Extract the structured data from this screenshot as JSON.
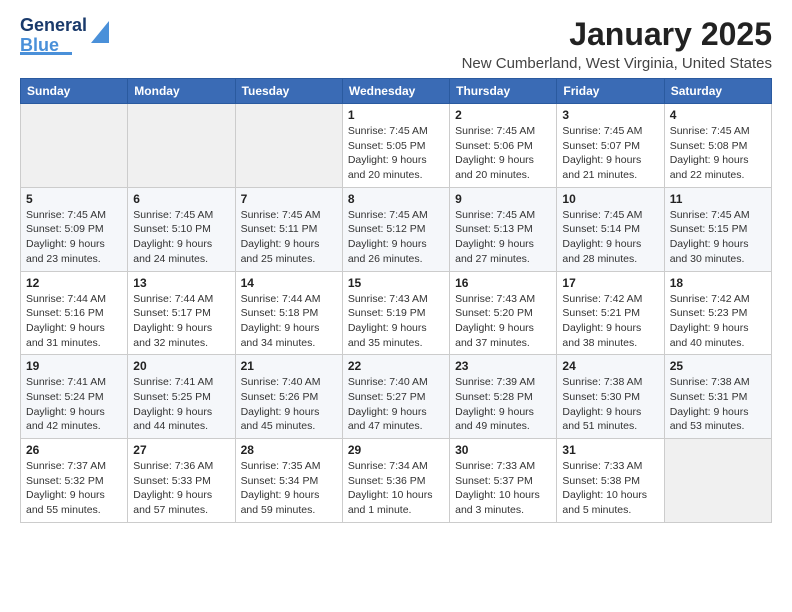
{
  "logo": {
    "line1": "General",
    "line2": "Blue"
  },
  "header": {
    "month": "January 2025",
    "location": "New Cumberland, West Virginia, United States"
  },
  "weekdays": [
    "Sunday",
    "Monday",
    "Tuesday",
    "Wednesday",
    "Thursday",
    "Friday",
    "Saturday"
  ],
  "weeks": [
    [
      {
        "day": "",
        "info": ""
      },
      {
        "day": "",
        "info": ""
      },
      {
        "day": "",
        "info": ""
      },
      {
        "day": "1",
        "info": "Sunrise: 7:45 AM\nSunset: 5:05 PM\nDaylight: 9 hours\nand 20 minutes."
      },
      {
        "day": "2",
        "info": "Sunrise: 7:45 AM\nSunset: 5:06 PM\nDaylight: 9 hours\nand 20 minutes."
      },
      {
        "day": "3",
        "info": "Sunrise: 7:45 AM\nSunset: 5:07 PM\nDaylight: 9 hours\nand 21 minutes."
      },
      {
        "day": "4",
        "info": "Sunrise: 7:45 AM\nSunset: 5:08 PM\nDaylight: 9 hours\nand 22 minutes."
      }
    ],
    [
      {
        "day": "5",
        "info": "Sunrise: 7:45 AM\nSunset: 5:09 PM\nDaylight: 9 hours\nand 23 minutes."
      },
      {
        "day": "6",
        "info": "Sunrise: 7:45 AM\nSunset: 5:10 PM\nDaylight: 9 hours\nand 24 minutes."
      },
      {
        "day": "7",
        "info": "Sunrise: 7:45 AM\nSunset: 5:11 PM\nDaylight: 9 hours\nand 25 minutes."
      },
      {
        "day": "8",
        "info": "Sunrise: 7:45 AM\nSunset: 5:12 PM\nDaylight: 9 hours\nand 26 minutes."
      },
      {
        "day": "9",
        "info": "Sunrise: 7:45 AM\nSunset: 5:13 PM\nDaylight: 9 hours\nand 27 minutes."
      },
      {
        "day": "10",
        "info": "Sunrise: 7:45 AM\nSunset: 5:14 PM\nDaylight: 9 hours\nand 28 minutes."
      },
      {
        "day": "11",
        "info": "Sunrise: 7:45 AM\nSunset: 5:15 PM\nDaylight: 9 hours\nand 30 minutes."
      }
    ],
    [
      {
        "day": "12",
        "info": "Sunrise: 7:44 AM\nSunset: 5:16 PM\nDaylight: 9 hours\nand 31 minutes."
      },
      {
        "day": "13",
        "info": "Sunrise: 7:44 AM\nSunset: 5:17 PM\nDaylight: 9 hours\nand 32 minutes."
      },
      {
        "day": "14",
        "info": "Sunrise: 7:44 AM\nSunset: 5:18 PM\nDaylight: 9 hours\nand 34 minutes."
      },
      {
        "day": "15",
        "info": "Sunrise: 7:43 AM\nSunset: 5:19 PM\nDaylight: 9 hours\nand 35 minutes."
      },
      {
        "day": "16",
        "info": "Sunrise: 7:43 AM\nSunset: 5:20 PM\nDaylight: 9 hours\nand 37 minutes."
      },
      {
        "day": "17",
        "info": "Sunrise: 7:42 AM\nSunset: 5:21 PM\nDaylight: 9 hours\nand 38 minutes."
      },
      {
        "day": "18",
        "info": "Sunrise: 7:42 AM\nSunset: 5:23 PM\nDaylight: 9 hours\nand 40 minutes."
      }
    ],
    [
      {
        "day": "19",
        "info": "Sunrise: 7:41 AM\nSunset: 5:24 PM\nDaylight: 9 hours\nand 42 minutes."
      },
      {
        "day": "20",
        "info": "Sunrise: 7:41 AM\nSunset: 5:25 PM\nDaylight: 9 hours\nand 44 minutes."
      },
      {
        "day": "21",
        "info": "Sunrise: 7:40 AM\nSunset: 5:26 PM\nDaylight: 9 hours\nand 45 minutes."
      },
      {
        "day": "22",
        "info": "Sunrise: 7:40 AM\nSunset: 5:27 PM\nDaylight: 9 hours\nand 47 minutes."
      },
      {
        "day": "23",
        "info": "Sunrise: 7:39 AM\nSunset: 5:28 PM\nDaylight: 9 hours\nand 49 minutes."
      },
      {
        "day": "24",
        "info": "Sunrise: 7:38 AM\nSunset: 5:30 PM\nDaylight: 9 hours\nand 51 minutes."
      },
      {
        "day": "25",
        "info": "Sunrise: 7:38 AM\nSunset: 5:31 PM\nDaylight: 9 hours\nand 53 minutes."
      }
    ],
    [
      {
        "day": "26",
        "info": "Sunrise: 7:37 AM\nSunset: 5:32 PM\nDaylight: 9 hours\nand 55 minutes."
      },
      {
        "day": "27",
        "info": "Sunrise: 7:36 AM\nSunset: 5:33 PM\nDaylight: 9 hours\nand 57 minutes."
      },
      {
        "day": "28",
        "info": "Sunrise: 7:35 AM\nSunset: 5:34 PM\nDaylight: 9 hours\nand 59 minutes."
      },
      {
        "day": "29",
        "info": "Sunrise: 7:34 AM\nSunset: 5:36 PM\nDaylight: 10 hours\nand 1 minute."
      },
      {
        "day": "30",
        "info": "Sunrise: 7:33 AM\nSunset: 5:37 PM\nDaylight: 10 hours\nand 3 minutes."
      },
      {
        "day": "31",
        "info": "Sunrise: 7:33 AM\nSunset: 5:38 PM\nDaylight: 10 hours\nand 5 minutes."
      },
      {
        "day": "",
        "info": ""
      }
    ]
  ]
}
